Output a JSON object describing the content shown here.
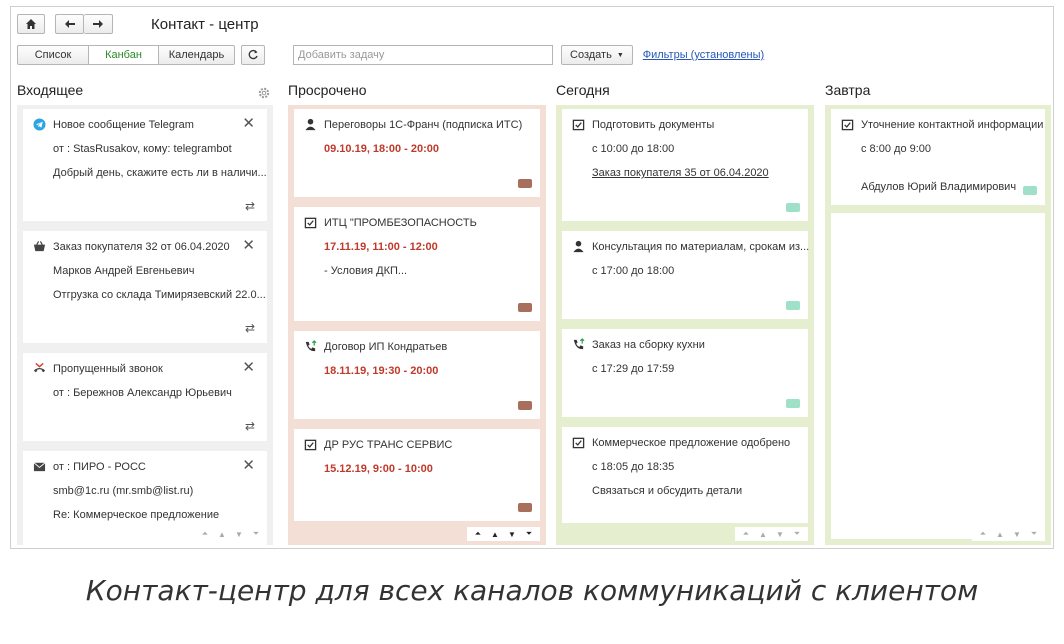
{
  "header": {
    "title": "Контакт - центр",
    "views": [
      "Список",
      "Канбан",
      "Календарь"
    ],
    "task_placeholder": "Добавить задачу",
    "create_label": "Создать",
    "filters_label": "Фильтры (установлены)"
  },
  "columns": {
    "inbox": {
      "title": "Входящее",
      "cards": [
        {
          "icon": "telegram-icon",
          "lines": [
            "Новое сообщение Telegram",
            "от : StasRusakov, кому: telegrambot",
            "Добрый день, скажите есть ли в наличи..."
          ]
        },
        {
          "icon": "basket-icon",
          "lines": [
            "Заказ покупателя 32 от 06.04.2020",
            "Марков Андрей Евгеньевич",
            "Отгрузка со склада Тимирязевский 22.0..."
          ]
        },
        {
          "icon": "missed-call-icon",
          "lines": [
            "Пропущенный звонок",
            "от : Бережнов Александр Юрьевич"
          ]
        },
        {
          "icon": "mail-icon",
          "lines": [
            "от : ПИРО - РОСС",
            "smb@1c.ru (mr.smb@list.ru)",
            "Re: Коммерческое предложение"
          ]
        }
      ]
    },
    "overdue": {
      "title": "Просрочено",
      "cards": [
        {
          "icon": "person-icon",
          "title": "Переговоры 1С-Франч (подписка ИТС)",
          "time": "09.10.19, 18:00 - 20:00"
        },
        {
          "icon": "task-icon",
          "title": "ИТЦ \"ПРОМБЕЗОПАСНОСТЬ",
          "time": "17.11.19, 11:00 - 12:00",
          "note": "- Условия ДКП..."
        },
        {
          "icon": "call-icon",
          "title": "Договор ИП Кондратьев",
          "time": "18.11.19, 19:30 - 20:00"
        },
        {
          "icon": "task-icon",
          "title": "ДР РУС ТРАНС СЕРВИС",
          "time": "15.12.19, 9:00 - 10:00"
        }
      ]
    },
    "today": {
      "title": "Сегодня",
      "cards": [
        {
          "icon": "task-icon",
          "title": "Подготовить документы",
          "time": "с 10:00 до 18:00",
          "note": "Заказ покупателя 35 от 06.04.2020"
        },
        {
          "icon": "person-icon",
          "title": "Консультация по материалам, срокам из...",
          "time": "с 17:00 до 18:00"
        },
        {
          "icon": "call-icon",
          "title": "Заказ на сборку кухни",
          "time": "с 17:29 до 17:59"
        },
        {
          "icon": "task-icon",
          "title": "Коммерческое предложение одобрено",
          "time": "с 18:05 до 18:35",
          "note": "Связаться и обсудить детали"
        }
      ]
    },
    "tomorrow": {
      "title": "Завтра",
      "cards": [
        {
          "icon": "task-icon",
          "title": "Уточнение контактной информации",
          "time": "с 8:00 до 9:00",
          "note": "Абдулов Юрий Владимирович"
        }
      ]
    }
  },
  "colors": {
    "overdue_bg": "#f4dfd6",
    "today_bg": "#e5efcf",
    "active_view": "#2a8a2a",
    "overdue_time": "#c0392b",
    "tag_brown": "#a8705c",
    "tag_teal": "#9ee0c8"
  },
  "caption": "Контакт-центр для всех каналов коммуникаций с клиентом"
}
